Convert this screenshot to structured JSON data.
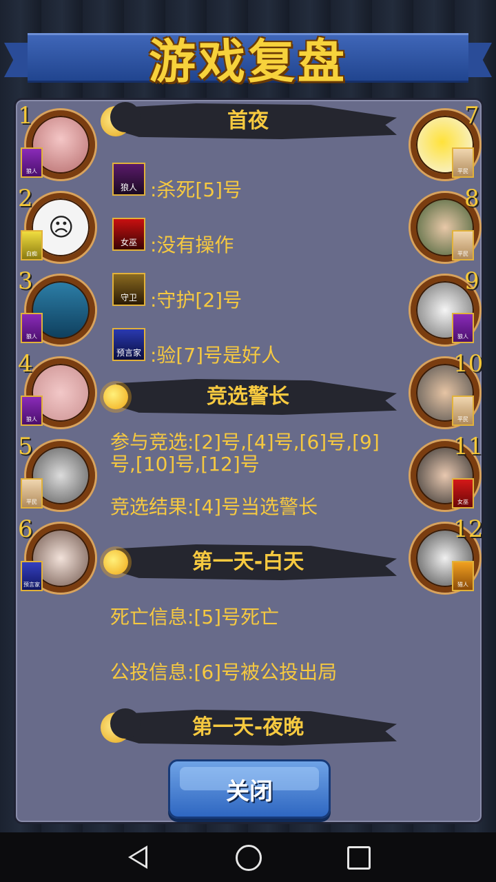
{
  "title": "游戏复盘",
  "players_left": [
    {
      "number": "1",
      "role": "狼人"
    },
    {
      "number": "2",
      "role": "白痴"
    },
    {
      "number": "3",
      "role": "狼人"
    },
    {
      "number": "4",
      "role": "狼人"
    },
    {
      "number": "5",
      "role": "平民"
    },
    {
      "number": "6",
      "role": "预言家"
    }
  ],
  "players_right": [
    {
      "number": "7",
      "role": "平民"
    },
    {
      "number": "8",
      "role": "平民"
    },
    {
      "number": "9",
      "role": "狼人"
    },
    {
      "number": "10",
      "role": "平民"
    },
    {
      "number": "11",
      "role": "女巫"
    },
    {
      "number": "12",
      "role": "猎人"
    }
  ],
  "sections": {
    "first_night": "首夜",
    "sheriff": "竞选警长",
    "day1": "第一天-白天",
    "night1": "第一天-夜晚"
  },
  "first_night_actions": [
    {
      "icon_label": "狼人",
      "text": ":杀死[5]号"
    },
    {
      "icon_label": "女巫",
      "text": ":没有操作"
    },
    {
      "icon_label": "守卫",
      "text": ":守护[2]号"
    },
    {
      "icon_label": "预言家",
      "text": ":验[7]号是好人"
    }
  ],
  "sheriff": {
    "candidates": "参与竞选:[2]号,[4]号,[6]号,[9]号,[10]号,[12]号",
    "result": "竞选结果:[4]号当选警长"
  },
  "day1": {
    "death": "死亡信息:[5]号死亡",
    "vote": "公投信息:[6]号被公投出局"
  },
  "close_label": "关闭",
  "colors": {
    "accent_text": "#f6c940",
    "panel": "#686b8a",
    "button": "#2f67c1"
  }
}
